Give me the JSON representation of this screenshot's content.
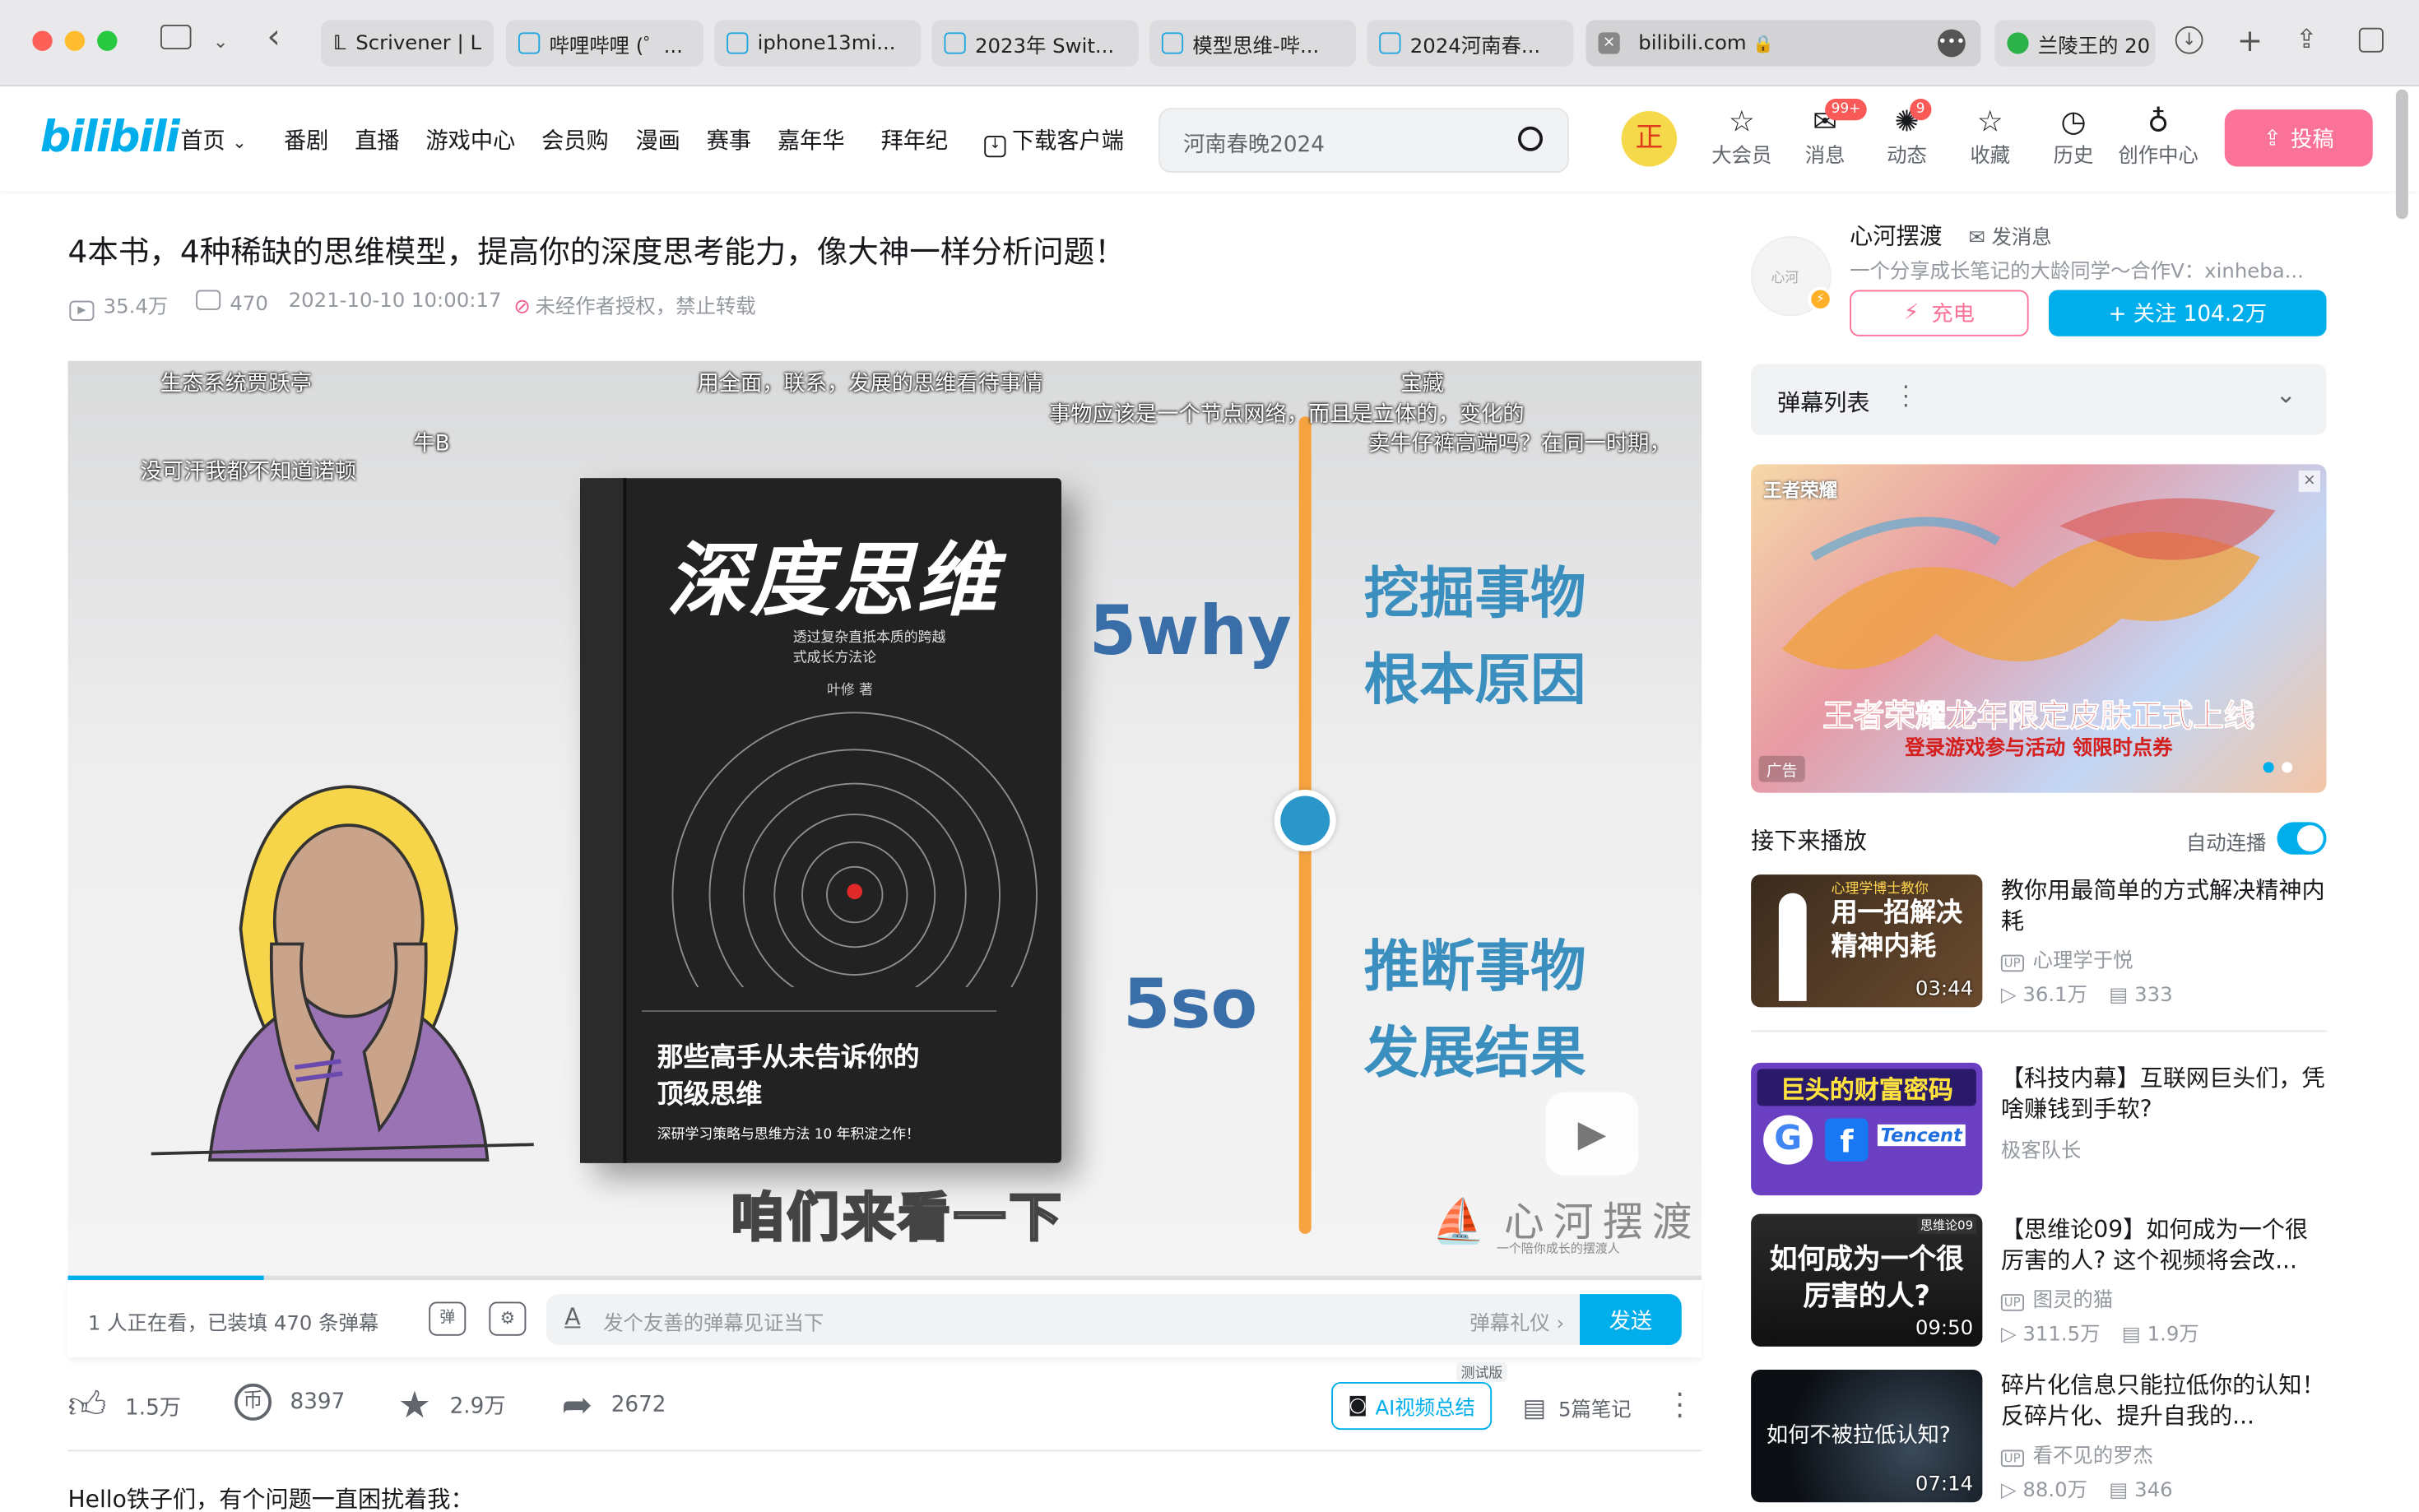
{
  "browser": {
    "tabs": [
      "Scrivener | L",
      "哔哩哔哩 (゜...",
      "iphone13mi...",
      "2023年 Swit...",
      "模型思维-哔...",
      "2024河南春...",
      "bilibili.com",
      "兰陵王的 20"
    ]
  },
  "nav": {
    "logo": "bilibili",
    "items": [
      "首页",
      "番剧",
      "直播",
      "游戏中心",
      "会员购",
      "漫画",
      "赛事",
      "嘉年华",
      "拜年纪",
      "下载客户端"
    ],
    "search_placeholder": "河南春晚2024",
    "avatar_text": "正",
    "right": [
      {
        "label": "大会员",
        "icon": "vip-icon"
      },
      {
        "label": "消息",
        "icon": "message-icon",
        "badge": "99+"
      },
      {
        "label": "动态",
        "icon": "dynamic-icon",
        "badge": "9"
      },
      {
        "label": "收藏",
        "icon": "favorite-icon"
      },
      {
        "label": "历史",
        "icon": "history-icon"
      },
      {
        "label": "创作中心",
        "icon": "creator-icon"
      }
    ],
    "upload": "投稿"
  },
  "video": {
    "title": "4本书，4种稀缺的思维模型，提高你的深度思考能力，像大神一样分析问题！",
    "views": "35.4万",
    "danmaku_count": "470",
    "date": "2021-10-10 10:00:17",
    "copyright": "未经作者授权，禁止转载",
    "danmaku": [
      "生态系统贾跃亭",
      "用全面，联系，发展的思维看待事情",
      "宝藏",
      "事物应该是一个节点网络，而且是立体的，变化的",
      "牛B",
      "卖牛仔裤高端吗？在同一时期，",
      "没可汗我都不知道诺顿"
    ],
    "book_title": "深度思维",
    "book_subtitle": "透过复杂直抵本质的跨越式成长方法论",
    "book_author": "叶修 著",
    "book_tagline": "那些高手从未告诉你的顶级思维",
    "book_footer": "深研学习策略与思维方法 10 年积淀之作！",
    "label_5why": "5why",
    "label_5so": "5so",
    "right_text_1": [
      "挖掘事物",
      "根本原因"
    ],
    "right_text_2": [
      "推断事物",
      "发展结果"
    ],
    "subtitle": "咱们来看一下",
    "watermark": "心河摆渡",
    "watermark_sub": "一个陪你成长的摆渡人",
    "progress": 0.12,
    "watching": "1 人正在看，已装填 470 条弹幕",
    "danmaku_placeholder": "发个友善的弹幕见证当下",
    "etiquette": "弹幕礼仪",
    "send": "发送"
  },
  "actions": {
    "like": "1.5万",
    "coin": "8397",
    "fav": "2.9万",
    "share": "2672",
    "ai": "AI视频总结",
    "ai_tag": "测试版",
    "notes": "5篇笔记"
  },
  "description": "Hello铁子们，有个问题一直困扰着我：",
  "uploader": {
    "name": "心河摆渡",
    "message": "发消息",
    "desc": "一个分享成长笔记的大龄同学～合作V：xinheba...",
    "charge": "充电",
    "follow": "+ 关注 104.2万"
  },
  "danmaku_list": "弹幕列表",
  "ad": {
    "title": "王者荣耀龙年限定皮肤正式上线",
    "sub": "登录游戏参与活动 领限时点券",
    "logo": "王者荣耀",
    "tag": "广告"
  },
  "next": {
    "label": "接下来播放",
    "autoplay": "自动连播"
  },
  "recommendations": [
    {
      "title": "教你用最简单的方式解决精神内耗",
      "author": "心理学于悦",
      "views": "36.1万",
      "danmaku": "333",
      "duration": "03:44",
      "thumb_text": "用一招解决 精神内耗",
      "thumb_kicker": "心理学博士教你"
    },
    {
      "title": "【科技内幕】互联网巨头们，凭啥赚钱到手软?",
      "author": "极客队长",
      "views": "",
      "danmaku": "",
      "duration": "",
      "thumb_text": "巨头的财富密码",
      "thumb_kicker": "Tencent"
    },
    {
      "title": "【思维论09】如何成为一个很厉害的人? 这个视频将会改...",
      "author": "图灵的猫",
      "views": "311.5万",
      "danmaku": "1.9万",
      "duration": "09:50",
      "thumb_text": "如何成为一个很厉害的人?",
      "thumb_kicker": "思维论09"
    },
    {
      "title": "碎片化信息只能拉低你的认知！反碎片化、提升自我的...",
      "author": "看不见的罗杰",
      "views": "88.0万",
      "danmaku": "346",
      "duration": "07:14",
      "thumb_text": "如何不被拉低认知?",
      "thumb_kicker": ""
    }
  ],
  "colors": {
    "brand_blue": "#00aeec",
    "brand_pink": "#fb7299",
    "text": "#18191c",
    "sub": "#9499a0"
  }
}
